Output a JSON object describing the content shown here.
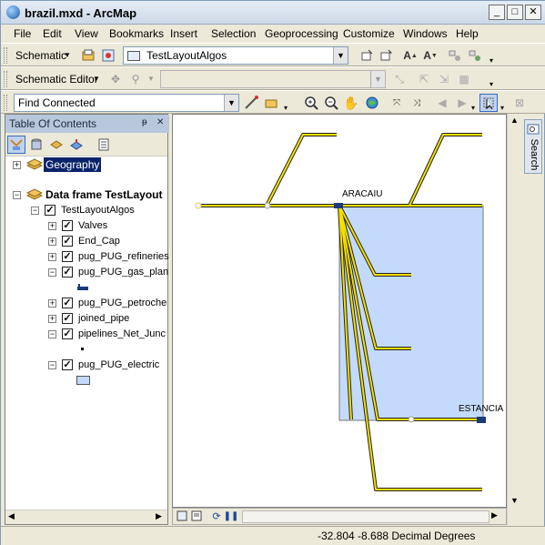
{
  "window": {
    "title": "brazil.mxd - ArcMap",
    "min": "_",
    "max": "□",
    "close": "✕"
  },
  "menu": [
    "File",
    "Edit",
    "View",
    "Bookmarks",
    "Insert",
    "Selection",
    "Geoprocessing",
    "Customize",
    "Windows",
    "Help"
  ],
  "schematic_toolbar": {
    "label": "Schematic",
    "diagram": "TestLayoutAlgos"
  },
  "schematic_editor": {
    "label": "Schematic Editor",
    "layout": ""
  },
  "find_connected": {
    "value": "Find Connected"
  },
  "toc": {
    "title": "Table Of Contents",
    "pin": "ᵽ",
    "close": "✕",
    "items": {
      "geography": "Geography",
      "data_frame": "Data frame TestLayout",
      "layout_algos": "TestLayoutAlgos",
      "valves": "Valves",
      "end_cap": "End_Cap",
      "refineries": "pug_PUG_refineries",
      "gas_plan": "pug_PUG_gas_plan",
      "petroche": "pug_PUG_petroche",
      "joined_pipe": "joined_pipe",
      "pipelines": "pipelines_Net_Junc",
      "electric": "pug_PUG_electric"
    }
  },
  "map": {
    "labels": {
      "aracaju": "ARACAIU",
      "estancia": "ESTANCIA"
    }
  },
  "search_tab": "Search",
  "status": {
    "coords": "-32.804  -8.688 Decimal Degrees"
  },
  "colors": {
    "accent": "#c4dafc",
    "pipeline": "#f5e000"
  }
}
